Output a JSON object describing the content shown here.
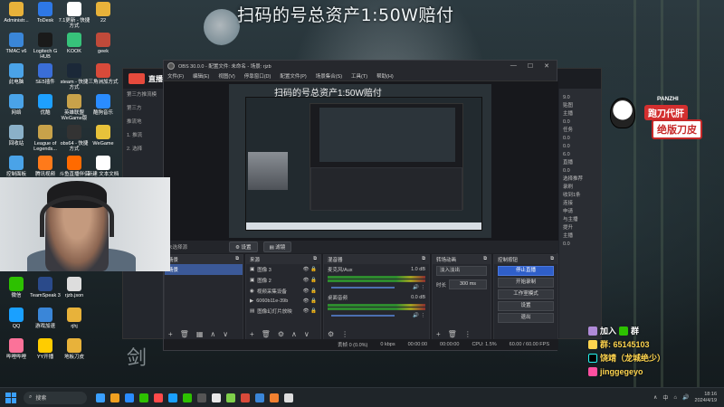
{
  "overlay": {
    "banner_top": "扫码的号总资产1:50W赔付",
    "preview_banner": "扫码的号总资产1:50W赔付",
    "side_art": "剑"
  },
  "desktop_icons": [
    {
      "label": "Administr...",
      "color": "#e8b23a"
    },
    {
      "label": "ToDesk",
      "color": "#2e78e6"
    },
    {
      "label": "7.1更新 - 快捷方式",
      "color": "#ffffff"
    },
    {
      "label": "22",
      "color": "#e8b23a"
    },
    {
      "label": "TMAC v6",
      "color": "#3a86d8"
    },
    {
      "label": "Logitech G HUB",
      "color": "#1a1a1a"
    },
    {
      "label": "KOOK",
      "color": "#37c27a"
    },
    {
      "label": "geek",
      "color": "#c04a3a"
    },
    {
      "label": "此电脑",
      "color": "#4aa3e8"
    },
    {
      "label": "SE5插件",
      "color": "#3a6ed8"
    },
    {
      "label": "steam - 快捷方式",
      "color": "#1b2838"
    },
    {
      "label": "三角洲加方式",
      "color": "#d84a3a"
    },
    {
      "label": "网络",
      "color": "#4aa3e8"
    },
    {
      "label": "优酷",
      "color": "#1ea0ff"
    },
    {
      "label": "英雄联盟WeGame版",
      "color": "#c8a24a"
    },
    {
      "label": "酷狗音乐",
      "color": "#2a8cff"
    },
    {
      "label": "回收站",
      "color": "#8ab0c8"
    },
    {
      "label": "League of Legends...",
      "color": "#c8a24a"
    },
    {
      "label": "obs64 - 快捷方式",
      "color": "#333333"
    },
    {
      "label": "WeGame",
      "color": "#e8c23a"
    },
    {
      "label": "控制面板",
      "color": "#4aa3e8"
    },
    {
      "label": "腾讯视频",
      "color": "#ff7a1a"
    },
    {
      "label": "斗鱼直播伴侣",
      "color": "#ff6a00"
    },
    {
      "label": "新建 文本文档",
      "color": "#ffffff"
    },
    {
      "label": "微信",
      "color": "#2dc100"
    },
    {
      "label": "TeamSpeak 3",
      "color": "#2a4a8a"
    },
    {
      "label": "rjzb.json",
      "color": "#dddddd"
    },
    {
      "label": "QQ",
      "color": "#1aa0ff"
    },
    {
      "label": "游戏加速",
      "color": "#3a86d8"
    },
    {
      "label": "rjhj",
      "color": "#e8b23a"
    },
    {
      "label": "哔哩哔哩",
      "color": "#fb7299"
    },
    {
      "label": "YY开播",
      "color": "#ffcc00"
    },
    {
      "label": "地板刀皮",
      "color": "#e8b23a"
    }
  ],
  "streamer_app": {
    "name": "直播伴",
    "left_items": [
      "第三方推流模",
      "第三方",
      "推流地",
      "1. 推流",
      "2. 选择"
    ],
    "right_items": [
      "9.0",
      "贴图",
      "主播",
      "0.0",
      "任务",
      "0.0",
      "0.0",
      "6.0",
      "直播",
      "0.0",
      "选择推荐",
      "录刷",
      "收到1条",
      "连接",
      "申请",
      "与主播",
      "提升",
      "主播",
      "0.0"
    ]
  },
  "obs": {
    "title": "OBS 30.0.0 - 配置文件: 未命名 - 场景: rjzb",
    "window_controls": [
      "—",
      "☐",
      "✕"
    ],
    "menu": [
      "文件(F)",
      "编辑(E)",
      "视图(V)",
      "停靠窗口(D)",
      "配置文件(P)",
      "场景集合(S)",
      "工具(T)",
      "帮助(H)"
    ],
    "toolbar_text": "未选择源",
    "toolbar_buttons": [
      "设置",
      "滤镜"
    ],
    "scenes": {
      "title": "场景",
      "items": [
        "场景"
      ],
      "selected": 0
    },
    "sources": {
      "title": "来源",
      "items": [
        "图像 3",
        "图像 2",
        "视频采集设备",
        "6060b11e-39b",
        "图像幻灯片放映"
      ]
    },
    "mixer": {
      "title": "混音器",
      "channels": [
        {
          "name": "麦克风/Aux",
          "db": "1.0 dB"
        },
        {
          "name": "桌面音频",
          "db": "0.0 dB"
        }
      ]
    },
    "transitions": {
      "title": "转场动画",
      "type": "淡入淡出",
      "duration_label": "时长",
      "duration": "300 ms"
    },
    "controls": {
      "title": "控制按钮",
      "buttons": [
        "停止直播",
        "开始录制",
        "工作室模式",
        "设置",
        "退出"
      ]
    },
    "status": {
      "dropped": "丢帧 0 (0.0%)",
      "bitrate": "0 kbps",
      "stream_time": "00:00:00",
      "rec_time": "00:00:00",
      "cpu": "CPU: 1.5%",
      "fps": "60.00 / 60.00 FPS"
    }
  },
  "sponsor": {
    "brand": "PANZHI",
    "line1": "跑刀代肝",
    "line2": "绝版刀皮"
  },
  "social": {
    "line1": "加入",
    "line1_b": "群",
    "line2": "群: 65145103",
    "line3": "饶靖（龙城绝少）",
    "line4": "jinggegeyo"
  },
  "taskbar": {
    "search": "搜索",
    "time": "18:16",
    "date": "2024/4/19",
    "ime": "中",
    "apps": [
      "#3aa0ff",
      "#f0a020",
      "#2a8cff",
      "#2dc100",
      "#ff4a4a",
      "#1aa0ff",
      "#2dc100",
      "#555555",
      "#e8e8e8",
      "#7fd04a",
      "#d84a3a",
      "#3a86d8",
      "#f08030",
      "#dddddd"
    ]
  }
}
